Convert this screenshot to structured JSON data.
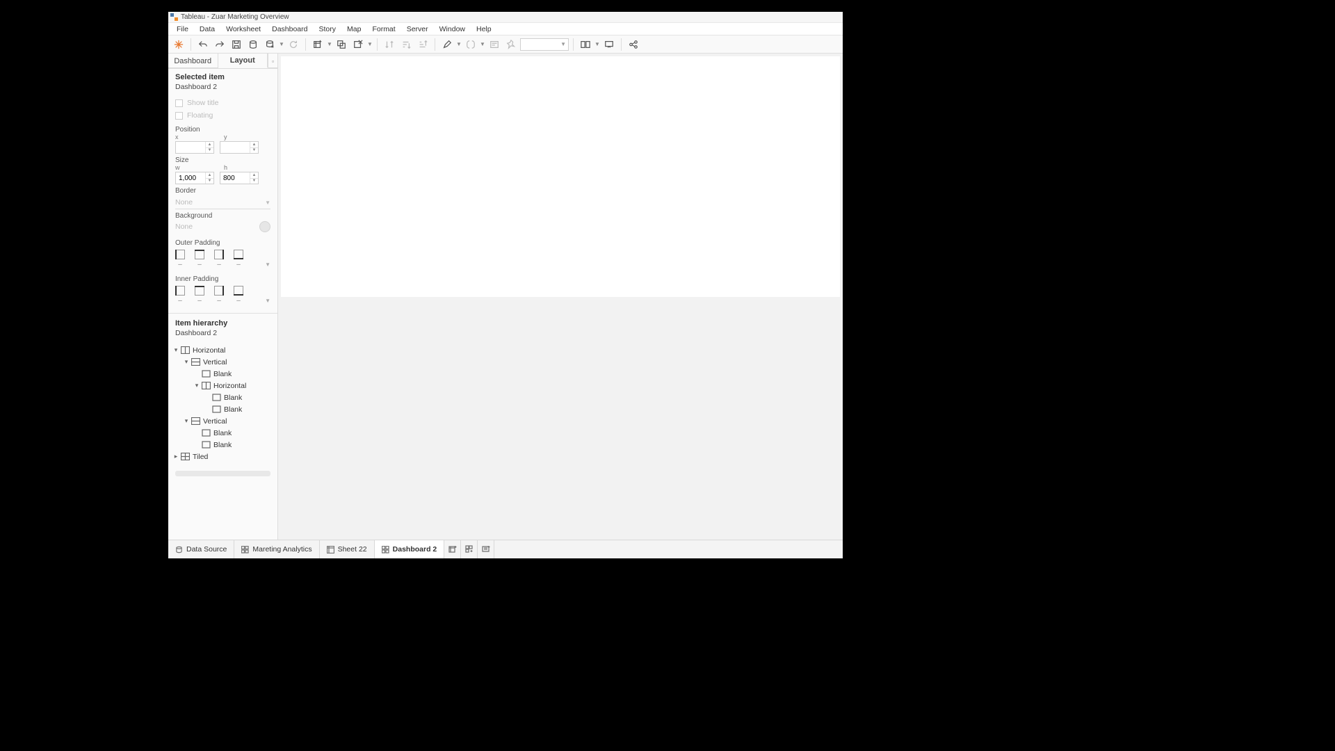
{
  "title": "Tableau - Zuar Marketing Overview",
  "menu": [
    "File",
    "Data",
    "Worksheet",
    "Dashboard",
    "Story",
    "Map",
    "Format",
    "Server",
    "Window",
    "Help"
  ],
  "pane_tabs": {
    "dashboard": "Dashboard",
    "layout": "Layout"
  },
  "selected_item": {
    "heading": "Selected item",
    "name": "Dashboard 2"
  },
  "checks": {
    "show_title": "Show title",
    "floating": "Floating"
  },
  "position": {
    "label": "Position",
    "x_label": "x",
    "y_label": "y",
    "x": "",
    "y": ""
  },
  "size": {
    "label": "Size",
    "w_label": "w",
    "h_label": "h",
    "w": "1,000",
    "h": "800"
  },
  "border": {
    "label": "Border",
    "value": "None"
  },
  "background": {
    "label": "Background",
    "value": "None"
  },
  "outer_padding": {
    "label": "Outer Padding",
    "vals": [
      "–",
      "–",
      "–",
      "–"
    ]
  },
  "inner_padding": {
    "label": "Inner Padding",
    "vals": [
      "–",
      "–",
      "–",
      "–"
    ]
  },
  "hierarchy": {
    "heading": "Item hierarchy",
    "root": "Dashboard 2",
    "rows": [
      {
        "depth": 0,
        "toggle": "▾",
        "icon": "h",
        "label": "Horizontal"
      },
      {
        "depth": 1,
        "toggle": "▾",
        "icon": "v",
        "label": "Vertical"
      },
      {
        "depth": 2,
        "toggle": "",
        "icon": "b",
        "label": "Blank"
      },
      {
        "depth": 2,
        "toggle": "▾",
        "icon": "h",
        "label": "Horizontal"
      },
      {
        "depth": 3,
        "toggle": "",
        "icon": "b",
        "label": "Blank"
      },
      {
        "depth": 3,
        "toggle": "",
        "icon": "b",
        "label": "Blank"
      },
      {
        "depth": 1,
        "toggle": "▾",
        "icon": "v",
        "label": "Vertical"
      },
      {
        "depth": 2,
        "toggle": "",
        "icon": "b",
        "label": "Blank"
      },
      {
        "depth": 2,
        "toggle": "",
        "icon": "b",
        "label": "Blank"
      },
      {
        "depth": 0,
        "toggle": "▸",
        "icon": "t",
        "label": "Tiled"
      }
    ]
  },
  "sheets": {
    "data_source": "Data Source",
    "tabs": [
      {
        "icon": "dash",
        "label": "Mareting Analytics",
        "active": false
      },
      {
        "icon": "sheet",
        "label": "Sheet 22",
        "active": false
      },
      {
        "icon": "dash",
        "label": "Dashboard 2",
        "active": true
      }
    ]
  }
}
